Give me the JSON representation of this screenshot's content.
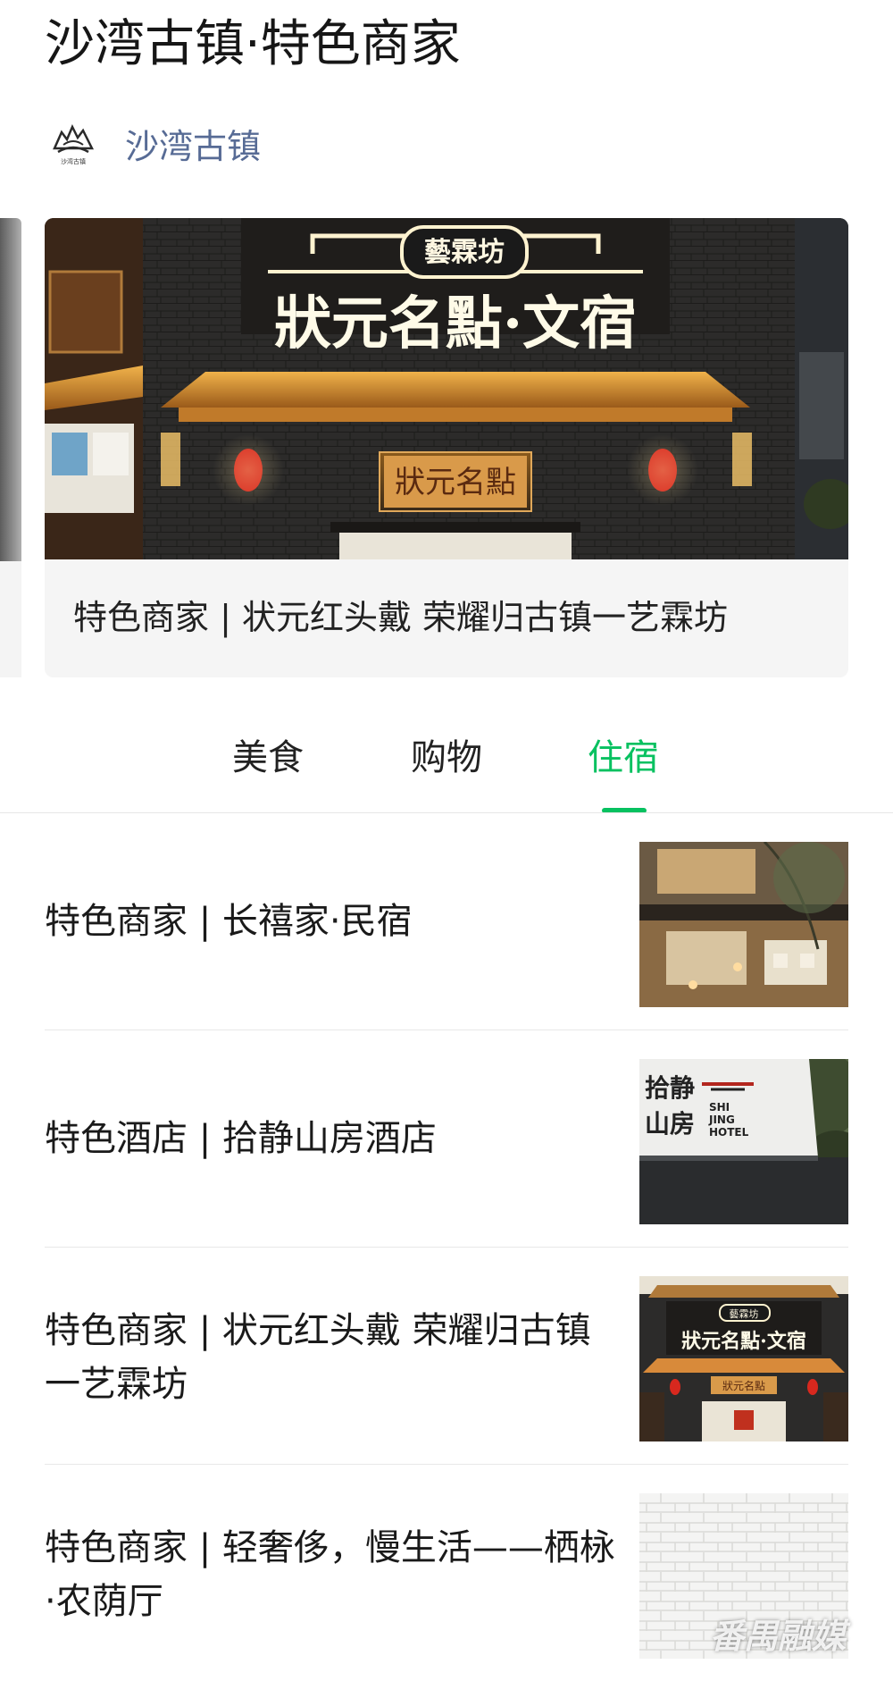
{
  "article": {
    "title": "沙湾古镇·特色商家"
  },
  "account": {
    "name": "沙湾古镇",
    "logo_icon": "shawan-town-logo-icon",
    "logo_caption": "沙湾古镇"
  },
  "carousel": {
    "caption": "特色商家 | 状元红头戴 荣耀归古镇一艺霖坊",
    "image_signs": {
      "top_plaque": "藝霖坊",
      "main_sign": "狀元名點·文宿",
      "door_sign": "狀元名點"
    }
  },
  "tabs": {
    "items": [
      {
        "label": "美食",
        "active": false
      },
      {
        "label": "购物",
        "active": false
      },
      {
        "label": "住宿",
        "active": true
      }
    ],
    "active_color": "#07c160"
  },
  "list": [
    {
      "title": "特色商家 | 长禧家·民宿",
      "thumb_icon": "homestay-interior-photo"
    },
    {
      "title": "特色酒店 | 拾静山房酒店",
      "thumb_icon": "hotel-sign-photo",
      "thumb_sign": "拾静山房"
    },
    {
      "title": "特色商家 | 状元红头戴 荣耀归古镇一艺霖坊",
      "thumb_icon": "shop-facade-photo"
    },
    {
      "title": "特色商家 | 轻奢侈，慢生活——栖栐·农荫厅",
      "thumb_icon": "brick-wall-photo"
    }
  ],
  "watermark": "番禺融媒",
  "colors": {
    "link": "#576b95",
    "accent_green": "#07c160",
    "divider": "#e6e6e6"
  }
}
